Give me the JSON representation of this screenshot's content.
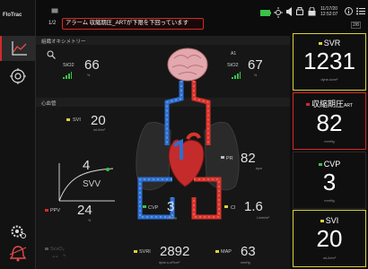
{
  "sidebar": {
    "brand": "FloTrac"
  },
  "topbar": {
    "alarm_count": "1/2",
    "alarm_text": "アラーム 収縮期圧_ARTが下限を下回っています",
    "date": "11/17/20",
    "time": "12:52:07",
    "lang_chip": "2/8"
  },
  "sections": {
    "oximetry": "組織オキシメトリー",
    "cardiac": "心血管"
  },
  "small_params": {
    "sto2_left": {
      "label": "StO2",
      "sub": "",
      "value": "66",
      "unit": "%"
    },
    "sto2_right": {
      "label": "StO2",
      "sub": "A1",
      "value": "67",
      "unit": "%"
    },
    "svi": {
      "label": "SVI",
      "value": "20",
      "unit": "mL/b/m²"
    },
    "svv": {
      "label": "SVV",
      "value": "4"
    },
    "ppv": {
      "label": "PPV",
      "value": "24",
      "unit": "%"
    },
    "cvp": {
      "label": "CVP",
      "value": "3",
      "unit": "mmHg"
    },
    "pr": {
      "label": "PR",
      "value": "82",
      "unit": "bpm"
    },
    "ci": {
      "label": "CI",
      "value": "1.6",
      "unit": "L/min/m²"
    },
    "sao2": {
      "label": "ScvO₂",
      "value": "--",
      "unit": "%"
    },
    "svri": {
      "label": "SVRI",
      "value": "2892",
      "unit": "dyne-s-m²/cm⁵"
    },
    "map": {
      "label": "MAP",
      "value": "63",
      "unit": "mmHg"
    }
  },
  "tiles": {
    "svr": {
      "label": "SVR",
      "value": "1231",
      "unit": "dyne-s/cm⁵",
      "color": "#d8d23a"
    },
    "sys_art": {
      "label": "収縮期圧",
      "label_sub": "ART",
      "value": "82",
      "unit": "mmHg",
      "color": "#d32a2a"
    },
    "cvp": {
      "label": "CVP",
      "value": "3",
      "unit": "mmHg",
      "color": "#2a2a2a"
    },
    "svi": {
      "label": "SVI",
      "value": "20",
      "unit": "mL/b/m²",
      "color": "#d8d23a"
    }
  },
  "colors": {
    "accent_red": "#d32a2a",
    "accent_yellow": "#d8d23a",
    "accent_green": "#3ac24a",
    "vessel_blue": "#2e6fd0",
    "vessel_red": "#d8342c"
  }
}
